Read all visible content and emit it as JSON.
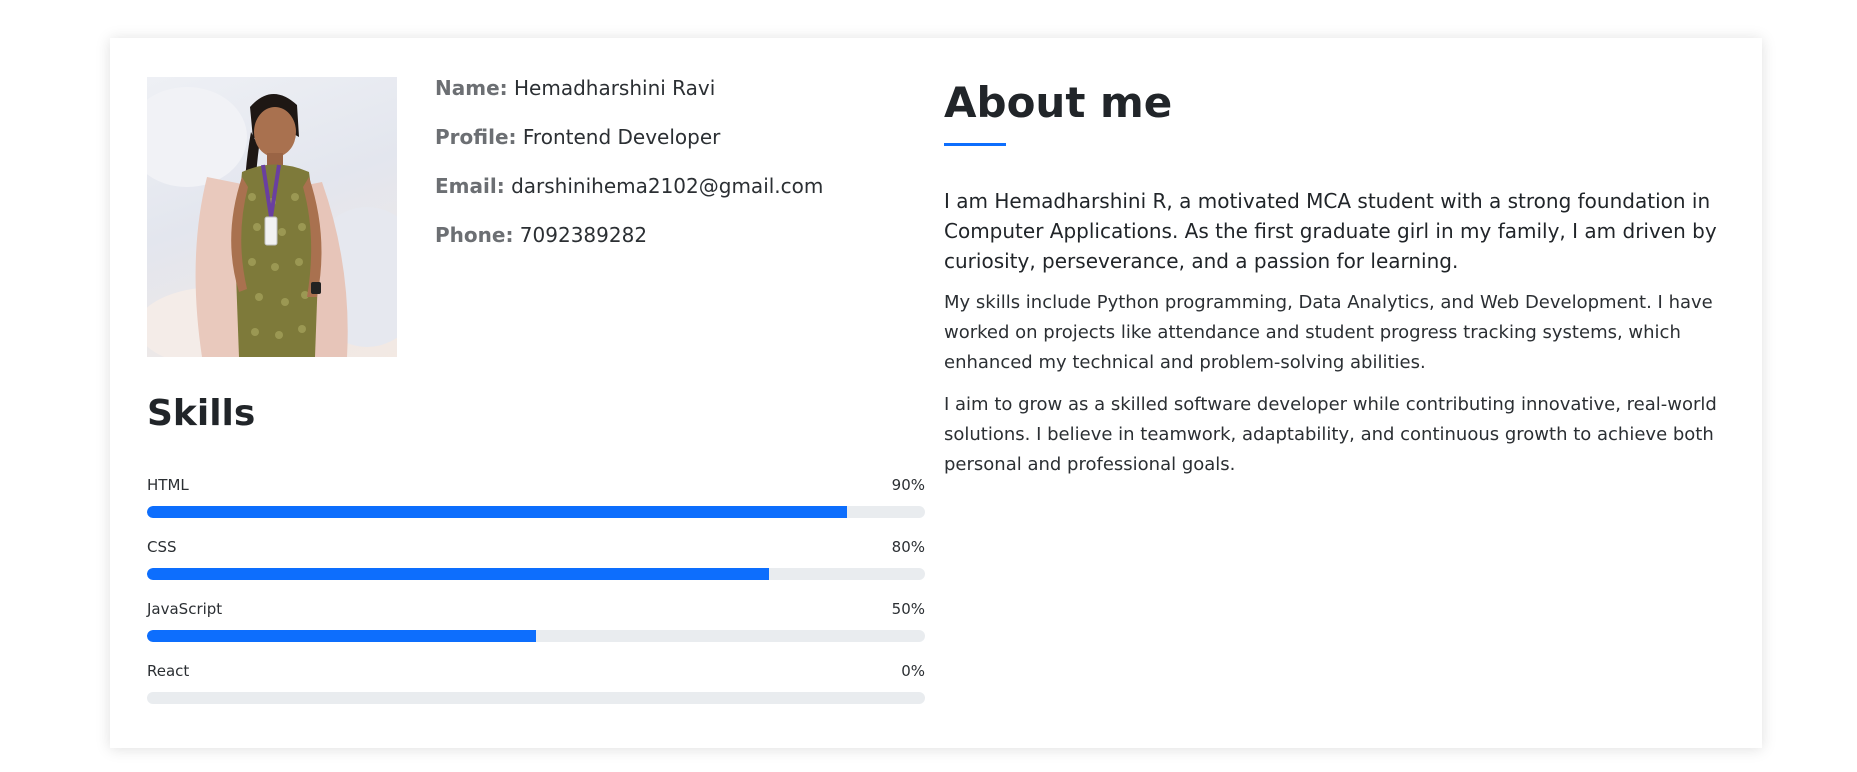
{
  "profile": {
    "name_key": "Name:",
    "name_value": "Hemadharshini Ravi",
    "profile_key": "Profile:",
    "profile_value": "Frontend Developer",
    "email_key": "Email:",
    "email_value": "darshinihema2102@gmail.com",
    "phone_key": "Phone:",
    "phone_value": "7092389282"
  },
  "skills": {
    "title": "Skills",
    "items": [
      {
        "label": "HTML",
        "percent_text": "90%",
        "level": 0.9
      },
      {
        "label": "CSS",
        "percent_text": "80%",
        "level": 0.8
      },
      {
        "label": "JavaScript",
        "percent_text": "50%",
        "level": 0.5
      },
      {
        "label": "React",
        "percent_text": "0%",
        "level": 0
      }
    ]
  },
  "about": {
    "title": "About me",
    "lead": "I am Hemadharshini R, a motivated MCA student with a strong foundation in Computer Applications. As the first graduate girl in my family, I am driven by curiosity, perseverance, and a passion for learning.",
    "paragraph_2": "My skills include Python programming, Data Analytics, and Web Development. I have worked on projects like attendance and student progress tracking systems, which enhanced my technical and problem-solving abilities.",
    "paragraph_3": "I aim to grow as a skilled software developer while contributing innovative, real-world solutions. I believe in teamwork, adaptability, and continuous growth to achieve both personal and professional goals."
  },
  "colors": {
    "accent": "#0d6efd",
    "track": "#e9ecef",
    "label_muted": "#6c6f73"
  }
}
